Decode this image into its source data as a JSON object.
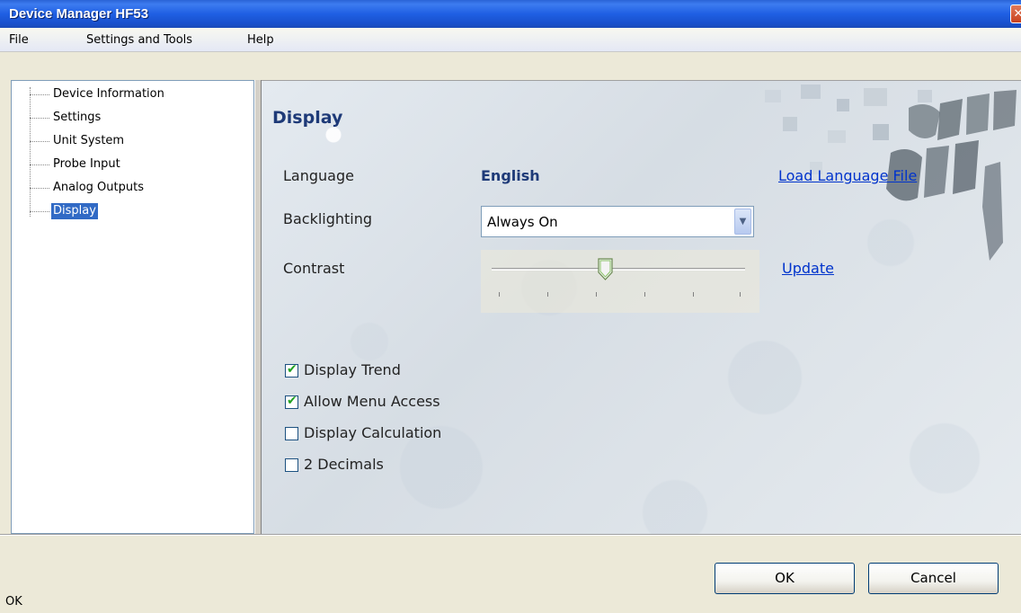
{
  "window": {
    "title": "Device Manager HF53",
    "close_symbol": "✕"
  },
  "menu": [
    "File",
    "Settings and Tools",
    "Help"
  ],
  "tree": {
    "items": [
      {
        "label": "Device Information",
        "selected": false
      },
      {
        "label": "Settings",
        "selected": false
      },
      {
        "label": "Unit System",
        "selected": false
      },
      {
        "label": "Probe Input",
        "selected": false
      },
      {
        "label": "Analog Outputs",
        "selected": false
      },
      {
        "label": "Display",
        "selected": true
      }
    ]
  },
  "display": {
    "title": "Display",
    "language_label": "Language",
    "language_value": "English",
    "load_language_link": "Load Language File",
    "backlighting_label": "Backlighting",
    "backlighting_value": "Always On",
    "contrast_label": "Contrast",
    "contrast_level": 0.45,
    "update_link": "Update",
    "checkboxes": [
      {
        "label": "Display Trend",
        "checked": true
      },
      {
        "label": "Allow Menu Access",
        "checked": true
      },
      {
        "label": "Display Calculation",
        "checked": false
      },
      {
        "label": "2 Decimals",
        "checked": false
      }
    ]
  },
  "buttons": {
    "ok": "OK",
    "cancel": "Cancel"
  },
  "status": "OK",
  "colors": {
    "titlebar": "#1f5fe3",
    "selection": "#316ac5",
    "heading": "#1e3a78",
    "link": "#0033cc",
    "check": "#21a121"
  }
}
